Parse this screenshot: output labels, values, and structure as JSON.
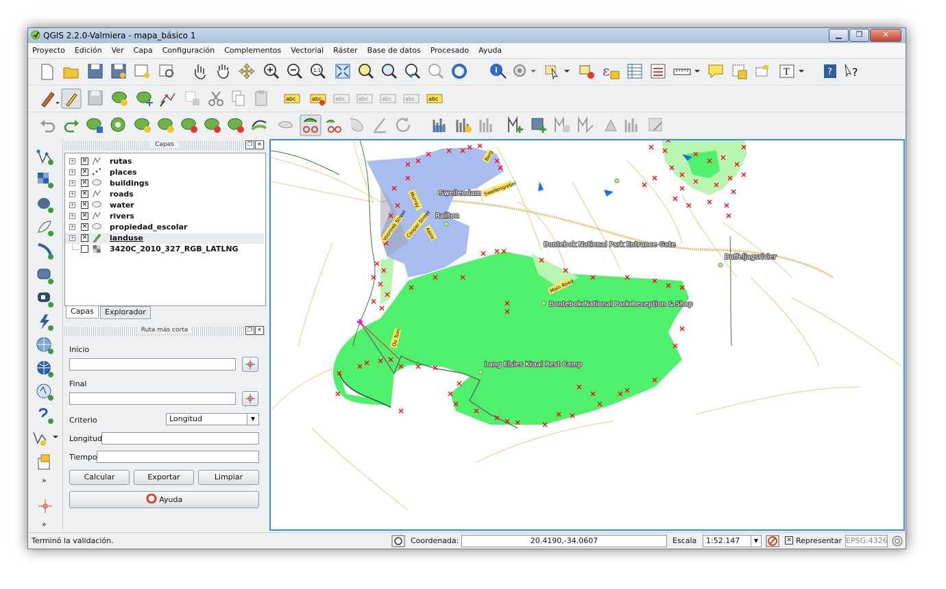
{
  "window": {
    "title": "QGIS 2.2.0-Valmiera - mapa_básico 1"
  },
  "menu": [
    "Proyecto",
    "Edición",
    "Ver",
    "Capa",
    "Configuración",
    "Complementos",
    "Vectorial",
    "Ráster",
    "Base de datos",
    "Procesado",
    "Ayuda"
  ],
  "layers_panel": {
    "title": "Capas",
    "layers": [
      {
        "name": "rutas",
        "checked": true,
        "icon": "line-layer-icon"
      },
      {
        "name": "places",
        "checked": true,
        "icon": "point-layer-icon"
      },
      {
        "name": "buildings",
        "checked": true,
        "icon": "polygon-layer-icon"
      },
      {
        "name": "roads",
        "checked": true,
        "icon": "line-layer-icon"
      },
      {
        "name": "water",
        "checked": true,
        "icon": "polygon-layer-icon"
      },
      {
        "name": "rivers",
        "checked": true,
        "icon": "line-layer-icon"
      },
      {
        "name": "propiedad_escolar",
        "checked": true,
        "icon": "polygon-layer-icon"
      },
      {
        "name": "landuse",
        "checked": true,
        "icon": "pencil-edit-icon"
      },
      {
        "name": "3420C_2010_327_RGB_LATLNG",
        "checked": false,
        "icon": "raster-layer-icon"
      }
    ],
    "tabs": [
      "Capas",
      "Explorador"
    ]
  },
  "route_panel": {
    "title": "Ruta más corta",
    "start_label": "Inicio",
    "end_label": "Final",
    "criterion_label": "Criterio",
    "criterion_value": "Longitud",
    "length_label": "Longitud",
    "time_label": "Tiempo",
    "calculate": "Calcular",
    "export": "Exportar",
    "clear": "Limpiar",
    "help": "Ayuda"
  },
  "map_labels": {
    "swellendam": "Swellendam",
    "railton": "Railton",
    "entrance": "Bontebok National Park Entrance Gate",
    "reception": "Bontebok National Park Reception & Shop",
    "buffel": "Buffeljagsrivier",
    "lang": "Lang Elsies Kraal Rest Camp",
    "berg": "Berg",
    "swellengrebel": "Swellengrebel",
    "murray": "Murray",
    "voortrek": "Voortrek Street",
    "cooper": "Cooper Street",
    "assia": "Assia",
    "main_road": "Main Road",
    "ou_tuin": "Ou Tuin"
  },
  "status": {
    "message": "Terminó la validación.",
    "coord_label": "Coordenada:",
    "coord_value": "20.4190,-34.0607",
    "scale_label": "Escala",
    "scale_value": "1:52.147",
    "render_label": "Representar",
    "epsg": "EPSG:4326"
  },
  "colors": {
    "landuse_green": "#4ff06b",
    "light_green": "#b7f5b0",
    "town_blue": "#a9bcee",
    "road": "#d9c37a",
    "marker": "#ff0000",
    "frame": "#3a8cd8"
  }
}
